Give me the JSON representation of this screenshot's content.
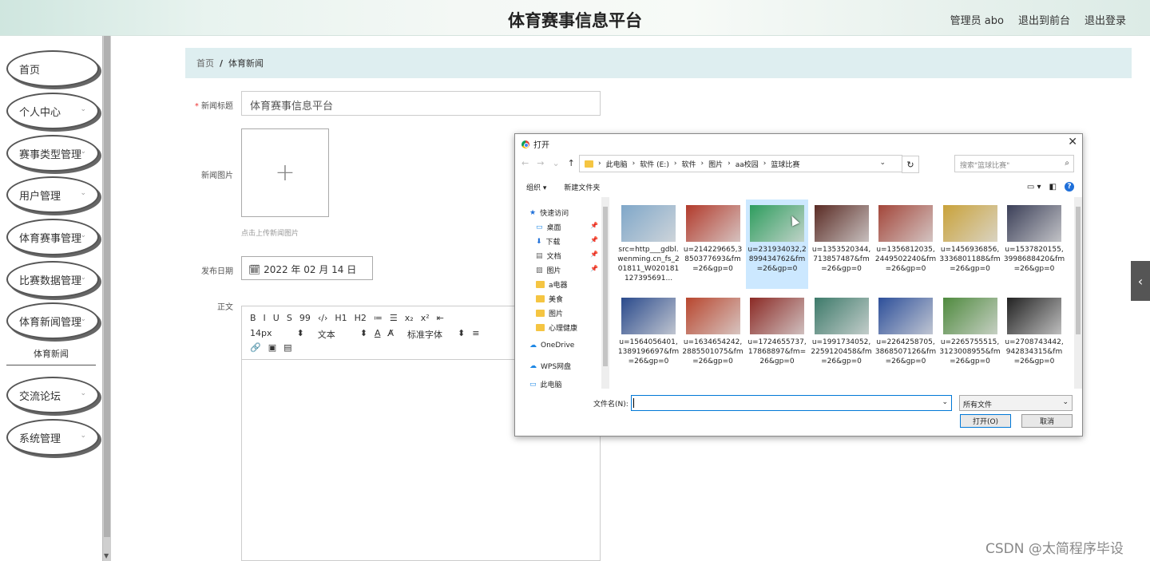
{
  "header": {
    "title": "体育赛事信息平台",
    "admin": "管理员 abo",
    "to_front": "退出到前台",
    "logout": "退出登录"
  },
  "sidebar": {
    "items": [
      {
        "label": "首页",
        "arrow": false
      },
      {
        "label": "个人中心",
        "arrow": true
      },
      {
        "label": "赛事类型管理",
        "arrow": true
      },
      {
        "label": "用户管理",
        "arrow": true
      },
      {
        "label": "体育赛事管理",
        "arrow": true
      },
      {
        "label": "比赛数据管理",
        "arrow": true
      },
      {
        "label": "体育新闻管理",
        "arrow": true
      },
      {
        "label": "交流论坛",
        "arrow": true
      },
      {
        "label": "系统管理",
        "arrow": true
      }
    ],
    "active_sub": "体育新闻"
  },
  "breadcrumb": {
    "home": "首页",
    "sep": "/",
    "current": "体育新闻"
  },
  "form": {
    "title_label": "新闻标题",
    "title_required": "*",
    "title_value": "体育赛事信息平台",
    "image_label": "新闻图片",
    "upload_plus": "+",
    "upload_hint": "点击上传新闻图片",
    "date_label": "发布日期",
    "date_value": "2022 年 02 月 14 日",
    "content_label": "正文"
  },
  "editor": {
    "row1": [
      "B",
      "I",
      "U",
      "S",
      "99",
      "‹/›",
      "H1",
      "H2",
      "≔",
      "☰",
      "x₂",
      "x²",
      "⇤"
    ],
    "font_size": "14px",
    "text_type": "文本",
    "font_family": "标准字体"
  },
  "dialog": {
    "title": "打开",
    "path": [
      "此电脑",
      "软件 (E:)",
      "软件",
      "图片",
      "aa校园",
      "篮球比赛"
    ],
    "search_placeholder": "搜索\"篮球比赛\"",
    "organize": "组织 ▾",
    "new_folder": "新建文件夹",
    "nav": [
      {
        "label": "快速访问",
        "icon": "star",
        "pinned": false
      },
      {
        "label": "桌面",
        "icon": "desktop",
        "pinned": true
      },
      {
        "label": "下载",
        "icon": "download",
        "pinned": true
      },
      {
        "label": "文档",
        "icon": "doc",
        "pinned": true
      },
      {
        "label": "图片",
        "icon": "pic",
        "pinned": true
      },
      {
        "label": "a电器",
        "icon": "folder",
        "pinned": false
      },
      {
        "label": "美食",
        "icon": "folder",
        "pinned": false
      },
      {
        "label": "图片",
        "icon": "folder",
        "pinned": false
      },
      {
        "label": "心理健康",
        "icon": "folder",
        "pinned": false
      },
      {
        "label": "OneDrive",
        "icon": "cloud",
        "pinned": false
      },
      {
        "label": "WPS网盘",
        "icon": "cloud",
        "pinned": false
      },
      {
        "label": "此电脑",
        "icon": "pc",
        "pinned": false
      }
    ],
    "files": [
      {
        "name": "src=http___gdbl.wenming.cn_fs_201811_W020181127395691...",
        "selected": false,
        "color": "#7fa7c9"
      },
      {
        "name": "u=214229665,3850377693&fm=26&gp=0",
        "selected": false,
        "color": "#b23a2b"
      },
      {
        "name": "u=231934032,2899434762&fm=26&gp=0",
        "selected": true,
        "color": "#2e9d5e"
      },
      {
        "name": "u=1353520344,713857487&fm=26&gp=0",
        "selected": false,
        "color": "#5a2b24"
      },
      {
        "name": "u=1356812035,2449502240&fm=26&gp=0",
        "selected": false,
        "color": "#a3463a"
      },
      {
        "name": "u=1456936856,3336801188&fm=26&gp=0",
        "selected": false,
        "color": "#c9a23a"
      },
      {
        "name": "u=1537820155,3998688420&fm=26&gp=0",
        "selected": false,
        "color": "#3b3f58"
      },
      {
        "name": "u=1564056401,1389196697&fm=26&gp=0",
        "selected": false,
        "color": "#2a4a8c"
      },
      {
        "name": "u=1634654242,2885501075&fm=26&gp=0",
        "selected": false,
        "color": "#b8462e"
      },
      {
        "name": "u=1724655737,17868897&fm=26&gp=0",
        "selected": false,
        "color": "#8b2a25"
      },
      {
        "name": "u=1991734052,2259120458&fm=26&gp=0",
        "selected": false,
        "color": "#3d7a6a"
      },
      {
        "name": "u=2264258705,3868507126&fm=26&gp=0",
        "selected": false,
        "color": "#2d4f9a"
      },
      {
        "name": "u=2265755515,3123008955&fm=26&gp=0",
        "selected": false,
        "color": "#4f8a3e"
      },
      {
        "name": "u=2708743442,942834315&fm=26&gp=0",
        "selected": false,
        "color": "#222222"
      }
    ],
    "filename_label": "文件名(N):",
    "filename_value": "",
    "filetype": "所有文件",
    "open_btn": "打开(O)",
    "cancel_btn": "取消"
  },
  "watermark": "CSDN @太简程序毕设"
}
